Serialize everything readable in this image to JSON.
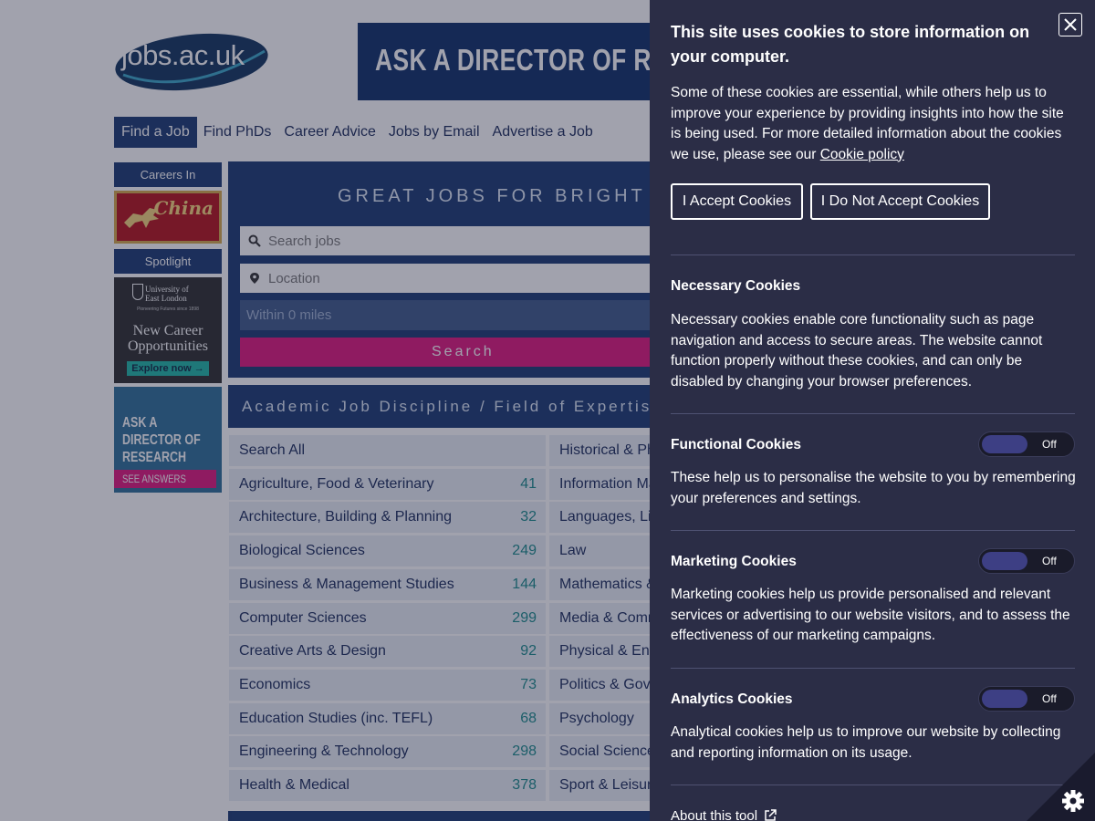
{
  "site": {
    "logo_text": "jobs.ac.uk",
    "banner_text": "ASK A DIRECTOR OF RESEAR"
  },
  "nav": {
    "items": [
      "Find a Job",
      "Find PhDs",
      "Career Advice",
      "Jobs by Email",
      "Advertise a Job"
    ],
    "active": "Find a Job"
  },
  "sidebar": {
    "careers_label": "Careers In",
    "china_ad_text": "China",
    "spotlight_label": "Spotlight",
    "uel": {
      "name_line1": "University of",
      "name_line2": "East London",
      "tagline": "Pioneering Futures since 1898",
      "heading_line1": "New Career",
      "heading_line2": "Opportunities",
      "button": "Explore now →"
    },
    "ask_ad": {
      "line1": "ASK A",
      "line2": "DIRECTOR OF",
      "line3": "RESEARCH",
      "button": "SEE ANSWERS"
    }
  },
  "search": {
    "title": "GREAT JOBS FOR BRIGHT",
    "keyword_placeholder": "Search jobs",
    "location_placeholder": "Location",
    "within": "Within 0 miles",
    "button": "Search"
  },
  "disciplines": {
    "heading": "Academic Job Discipline / Field of Expertise",
    "left": [
      {
        "label": "Search All",
        "count": ""
      },
      {
        "label": "Agriculture, Food & Veterinary",
        "count": "41"
      },
      {
        "label": "Architecture, Building & Planning",
        "count": "32"
      },
      {
        "label": "Biological Sciences",
        "count": "249"
      },
      {
        "label": "Business & Management Studies",
        "count": "144"
      },
      {
        "label": "Computer Sciences",
        "count": "299"
      },
      {
        "label": "Creative Arts & Design",
        "count": "92"
      },
      {
        "label": "Economics",
        "count": "73"
      },
      {
        "label": "Education Studies (inc. TEFL)",
        "count": "68"
      },
      {
        "label": "Engineering & Technology",
        "count": "298"
      },
      {
        "label": "Health & Medical",
        "count": "378"
      }
    ],
    "right": [
      "Historical & Phi",
      "Information Ma",
      "Languages, Lite",
      "Law",
      "Mathematics &",
      "Media & Comm",
      "Physical & Env",
      "Politics & Gove",
      "Psychology",
      "Social Sciences",
      "Sport & Leisure"
    ]
  },
  "cookie": {
    "title": "This site uses cookies to store information on your computer.",
    "intro": "Some of these cookies are essential, while others help us to improve your experience by providing insights into how the site is being used. For more detailed information about the cookies we use, please see our ",
    "policy_link": "Cookie policy",
    "accept": "I Accept Cookies",
    "decline": "I Do Not Accept Cookies",
    "necessary_title": "Necessary Cookies",
    "necessary_text": "Necessary cookies enable core functionality such as page navigation and access to secure areas. The website cannot function properly without these cookies, and can only be disabled by changing your browser preferences.",
    "functional_title": "Functional Cookies",
    "functional_toggle": "Off",
    "functional_text": "These help us to personalise the website to you by remembering your preferences and settings.",
    "marketing_title": "Marketing Cookies",
    "marketing_toggle": "Off",
    "marketing_text": "Marketing cookies help us provide personalised and relevant services or advertising to our website visitors, and to assess the effectiveness of our marketing campaigns.",
    "analytics_title": "Analytics Cookies",
    "analytics_toggle": "Off",
    "analytics_text": "Analytical cookies help us to improve our website by collecting and reporting information on its usage.",
    "about": "About this tool"
  },
  "colors": {
    "brand_navy": "#1b3a73",
    "accent_pink": "#e0187d",
    "panel_bg": "#2b2d46",
    "count_teal": "#1a8a8a"
  }
}
